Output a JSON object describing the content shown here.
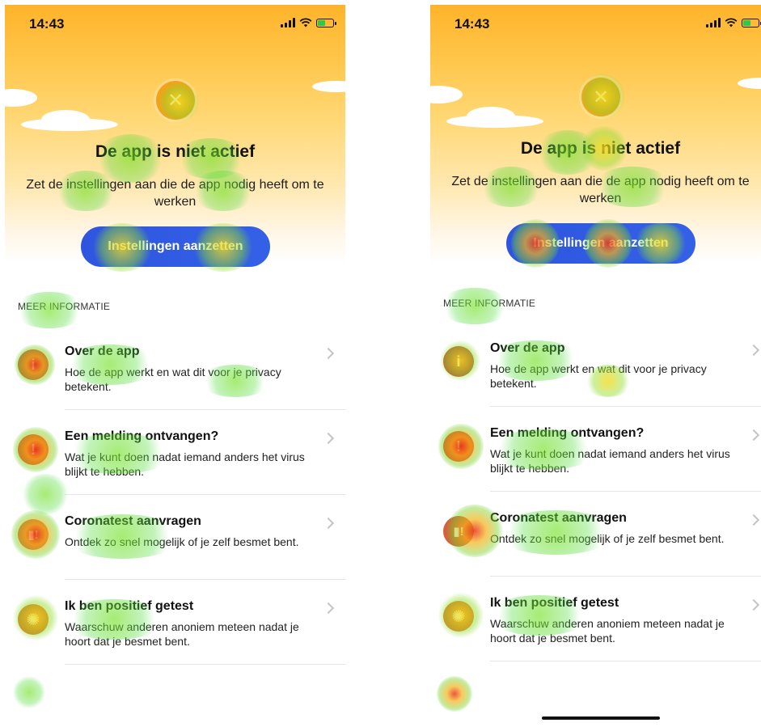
{
  "screens": [
    {
      "status_bar": {
        "time": "14:43"
      },
      "hero": {
        "status_icon": "close-icon",
        "title": "De app is niet actief",
        "subtitle": "Zet de instellingen aan die de app nodig heeft om te werken",
        "button_label": "Instellingen aanzetten"
      },
      "section_header": "MEER INFORMATIE",
      "items": [
        {
          "icon": "info-icon",
          "title": "Over de app",
          "desc": "Hoe de app werkt en wat dit voor je privacy betekent."
        },
        {
          "icon": "alert-icon",
          "title": "Een melding ontvangen?",
          "desc": "Wat je kunt doen nadat iemand anders het virus blijkt te hebben."
        },
        {
          "icon": "test-tube-icon",
          "title": "Coronatest aanvragen",
          "desc": "Ontdek zo snel mogelijk of je zelf besmet bent."
        },
        {
          "icon": "virus-icon",
          "title": "Ik ben positief getest",
          "desc": "Waarschuw anderen anoniem meteen nadat je hoort dat je besmet bent."
        }
      ]
    },
    {
      "status_bar": {
        "time": "14:43"
      },
      "hero": {
        "status_icon": "close-icon",
        "title": "De app is niet actief",
        "subtitle": "Zet de instellingen aan die de app nodig heeft om te werken",
        "button_label": "Instellingen aanzetten"
      },
      "section_header": "MEER INFORMATIE",
      "items": [
        {
          "icon": "info-icon",
          "title": "Over de app",
          "desc": "Hoe de app werkt en wat dit voor je privacy betekent."
        },
        {
          "icon": "alert-icon",
          "title": "Een melding ontvangen?",
          "desc": "Wat je kunt doen nadat iemand anders het virus blijkt te hebben."
        },
        {
          "icon": "test-tube-icon",
          "title": "Coronatest aanvragen",
          "desc": "Ontdek zo snel mogelijk of je zelf besmet bent."
        },
        {
          "icon": "virus-icon",
          "title": "Ik ben positief getest",
          "desc": "Waarschuw anderen anoniem meteen nadat je hoort dat je besmet bent."
        }
      ]
    }
  ],
  "colors": {
    "hero_top": "#ffb32a",
    "status_badge": "#f4a11b",
    "button": "#2f55e0",
    "info_icon": "#c2523a",
    "alert_icon": "#e5402a",
    "test_icon": "#d4603c",
    "virus_icon": "#e8742c",
    "heat_hot": "#e83a1c",
    "heat_warm": "#f6b218",
    "heat_cool": "#50dc3c"
  }
}
